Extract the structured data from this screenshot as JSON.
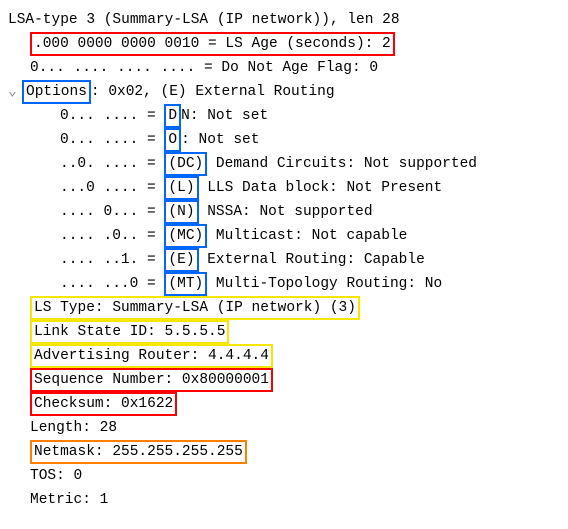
{
  "header": "LSA-type 3 (Summary-LSA (IP network)), len 28",
  "ls_age": ".000 0000 0000 0010 = LS Age (seconds): 2",
  "dna": "0... .... .... .... = Do Not Age Flag: 0",
  "options_label": "Options",
  "options_rest": ": 0x02, (E) External Routing",
  "tree_glyph": "⌄",
  "opt": {
    "dn": {
      "bits": "0... .... = ",
      "flag": "D",
      "rest": "N: Not set"
    },
    "o": {
      "bits": "0... .... = ",
      "flag": "O",
      "rest": ": Not set"
    },
    "dc": {
      "bits": "..0. .... = ",
      "flag": "(DC)",
      "rest": " Demand Circuits: Not supported"
    },
    "l": {
      "bits": "...0 .... = ",
      "flag": "(L)",
      "rest": " LLS Data block: Not Present"
    },
    "n": {
      "bits": ".... 0... = ",
      "flag": "(N)",
      "rest": " NSSA: Not supported"
    },
    "mc": {
      "bits": ".... .0.. = ",
      "flag": "(MC)",
      "rest": " Multicast: Not capable"
    },
    "e": {
      "bits": ".... ..1. = ",
      "flag": "(E)",
      "rest": " External Routing: Capable"
    },
    "mt": {
      "bits": ".... ...0 = ",
      "flag": "(MT)",
      "rest": " Multi-Topology Routing: No"
    }
  },
  "ls_type": "LS Type: Summary-LSA (IP network) (3)",
  "link_state_id": "Link State ID: 5.5.5.5",
  "adv_router": "Advertising Router: 4.4.4.4",
  "seq_num": "Sequence Number: 0x80000001",
  "checksum": "Checksum: 0x1622",
  "length": "Length: 28",
  "netmask": "Netmask: 255.255.255.255",
  "tos": "TOS: 0",
  "metric": "Metric: 1"
}
